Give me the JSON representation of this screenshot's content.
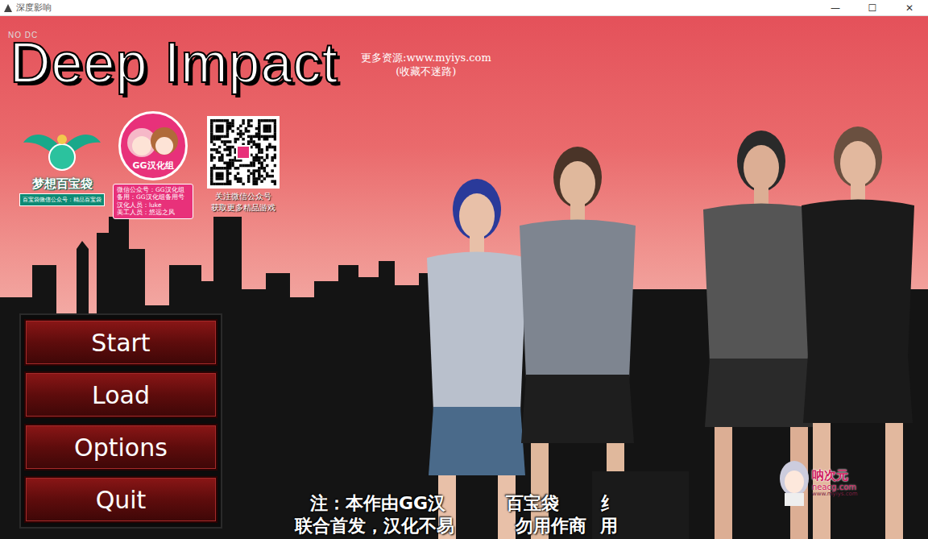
{
  "window": {
    "title": "深度影响",
    "controls": [
      "—",
      "☐",
      "✕"
    ]
  },
  "game": {
    "badge": "NO DC",
    "title": "Deep Impact"
  },
  "watermark": {
    "line1": "更多资源:www.myiys.com",
    "line2": "(收藏不迷路)"
  },
  "logo_baibaodai": {
    "name": "梦想百宝袋",
    "sub": "百宝袋微信公众号：精品百宝袋"
  },
  "logo_gg": {
    "name": "GG汉化组",
    "info": [
      "微信公众号：GG汉化组",
      "备用：GG汉化组备用号",
      "汉化人员：luke",
      "美工人员：悠远之风"
    ]
  },
  "qr": {
    "lines": [
      "关注微信公众号",
      "获取更多精品游戏"
    ]
  },
  "menu": [
    {
      "label": "Start"
    },
    {
      "label": "Load"
    },
    {
      "label": "Options"
    },
    {
      "label": "Quit"
    }
  ],
  "notice": {
    "lines": [
      [
        "注：本作由GG汉",
        "百宝袋",
        "纟"
      ],
      [
        "联合首发，汉化不易",
        "勿用作商",
        "用"
      ]
    ]
  },
  "corner_logo": {
    "name": "呐次元",
    "site": "neacg.com",
    "url": "www.myiys.com"
  }
}
